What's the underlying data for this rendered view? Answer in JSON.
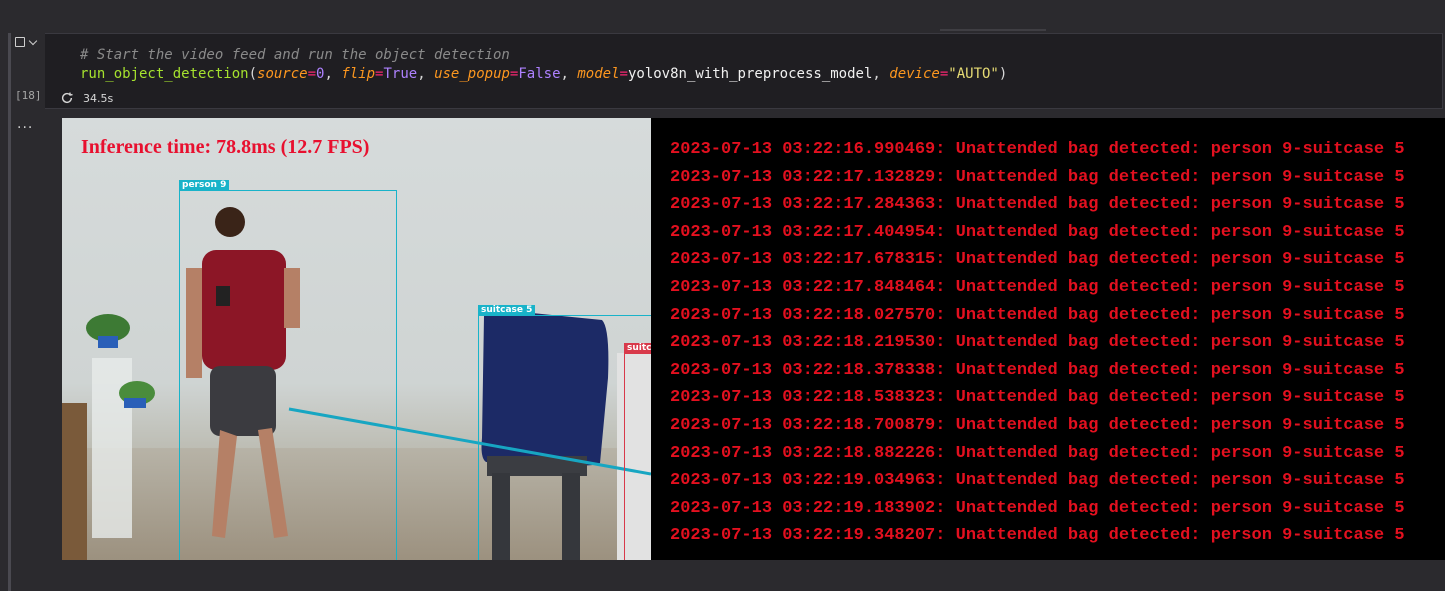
{
  "cell": {
    "execution_count": "[18]",
    "code_comment": "# Start the video feed and run the object detection",
    "code": {
      "fn": "run_object_detection",
      "open": "(",
      "arg1_name": "source",
      "arg1_value": "0",
      "arg2_name": "flip",
      "arg2_value": "True",
      "arg3_name": "use_popup",
      "arg3_value": "False",
      "arg4_name": "model",
      "arg4_value": "yolov8n_with_preprocess_model",
      "arg5_name": "device",
      "arg5_value": "\"AUTO\"",
      "eq": "=",
      "comma": ", ",
      "close": ")"
    },
    "duration": "34.5s",
    "output_indicator": "..."
  },
  "video": {
    "inference_text": "Inference time: 78.8ms (12.7 FPS)",
    "labels": {
      "person": "person 9",
      "suitcase": "suitcase 5",
      "suitcase_partial": "suitca"
    }
  },
  "log": {
    "lines": [
      "2023-07-13 03:22:16.990469: Unattended bag detected: person 9-suitcase 5",
      "2023-07-13 03:22:17.132829: Unattended bag detected: person 9-suitcase 5",
      "2023-07-13 03:22:17.284363: Unattended bag detected: person 9-suitcase 5",
      "2023-07-13 03:22:17.404954: Unattended bag detected: person 9-suitcase 5",
      "2023-07-13 03:22:17.678315: Unattended bag detected: person 9-suitcase 5",
      "2023-07-13 03:22:17.848464: Unattended bag detected: person 9-suitcase 5",
      "2023-07-13 03:22:18.027570: Unattended bag detected: person 9-suitcase 5",
      "2023-07-13 03:22:18.219530: Unattended bag detected: person 9-suitcase 5",
      "2023-07-13 03:22:18.378338: Unattended bag detected: person 9-suitcase 5",
      "2023-07-13 03:22:18.538323: Unattended bag detected: person 9-suitcase 5",
      "2023-07-13 03:22:18.700879: Unattended bag detected: person 9-suitcase 5",
      "2023-07-13 03:22:18.882226: Unattended bag detected: person 9-suitcase 5",
      "2023-07-13 03:22:19.034963: Unattended bag detected: person 9-suitcase 5",
      "2023-07-13 03:22:19.183902: Unattended bag detected: person 9-suitcase 5",
      "2023-07-13 03:22:19.348207: Unattended bag detected: person 9-suitcase 5"
    ]
  },
  "colors": {
    "log_text": "#e3101f",
    "bbox": "#19b3c9",
    "bbox_alt": "#d8394a"
  }
}
